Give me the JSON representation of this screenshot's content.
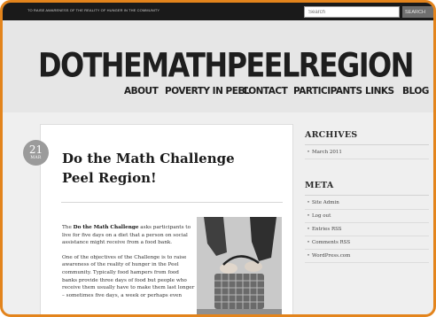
{
  "topbar": {
    "tagline": "TO RAISE AWARENESS OF THE REALITY OF HUNGER IN THE COMMUNITY",
    "search_placeholder": "Search",
    "search_button": "SEARCH"
  },
  "header": {
    "site_title": "DOTHEMATHPEELREGION"
  },
  "nav": {
    "items": [
      "ABOUT",
      "POVERTY IN PEEL",
      "CONTACT",
      "PARTICIPANTS",
      "LINKS",
      "BLOG"
    ]
  },
  "post": {
    "date_day": "21",
    "date_month": "MAR",
    "title": "Do the Math Challenge Peel Region!",
    "para1_prefix": "The ",
    "para1_bold": "Do the Math Challenge",
    "para1_rest": " asks participants to live for five days on a diet that a person on social assistance might receive from a food bank.",
    "para2": "One of the objectives of the Challenge is to raise awareness of the reality of hunger in the Peel community. Typically food hampers from food banks provide three days of food but people who receive them usually have to make them last longer – sometimes five days, a week or perhaps even"
  },
  "sidebar": {
    "archives_heading": "ARCHIVES",
    "archives_items": [
      "March 2011"
    ],
    "meta_heading": "META",
    "meta_items": [
      "Site Admin",
      "Log out",
      "Entries RSS",
      "Comments RSS",
      "WordPress.com"
    ]
  },
  "colors": {
    "frame_border": "#e3841c",
    "topbar": "#1a1a1a",
    "date_badge": "#9b9b9b"
  }
}
